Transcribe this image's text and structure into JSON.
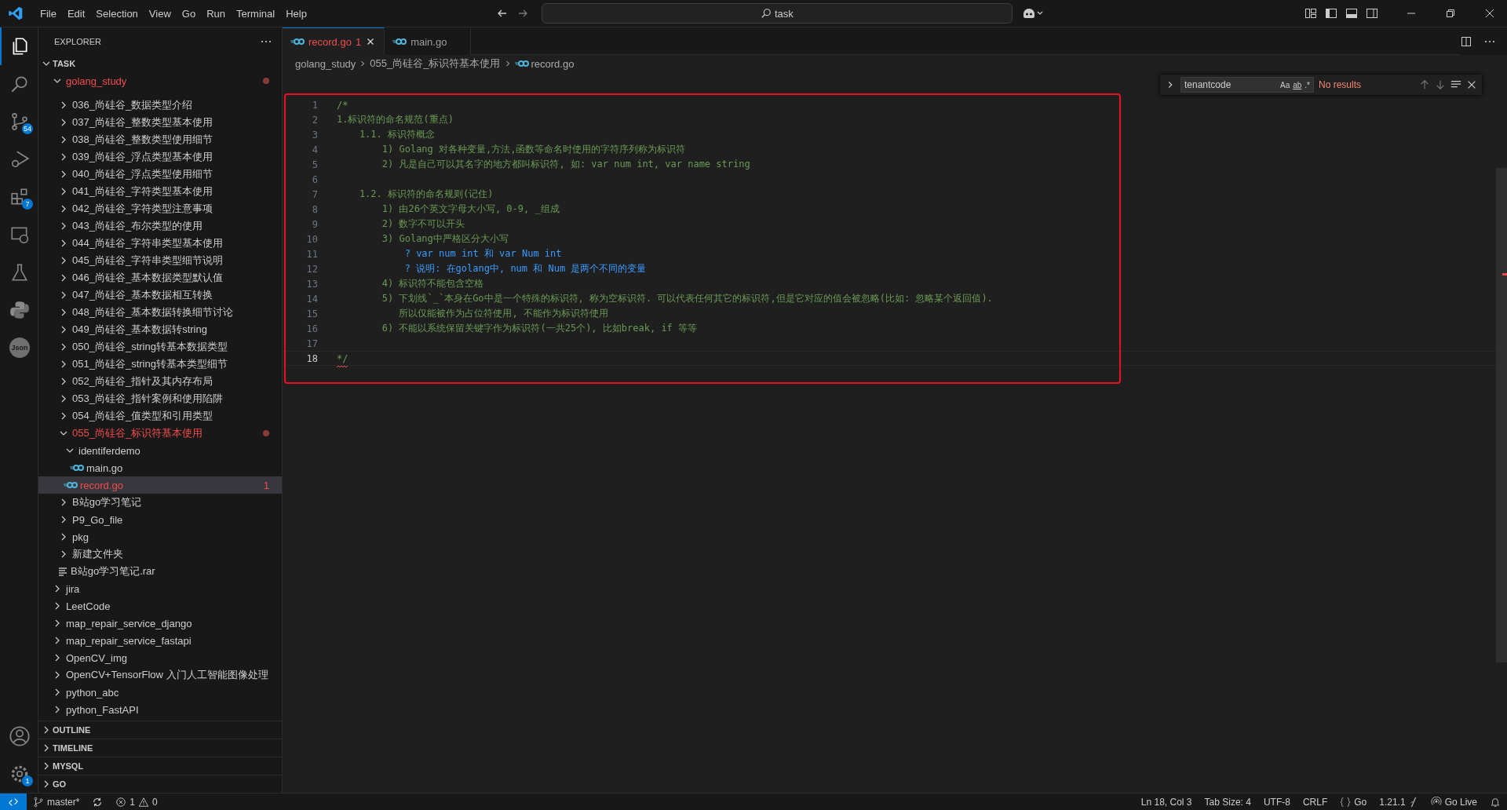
{
  "title_bar": {
    "menu": [
      "File",
      "Edit",
      "Selection",
      "View",
      "Go",
      "Run",
      "Terminal",
      "Help"
    ],
    "search": "task"
  },
  "activity_bar": {
    "items": [
      {
        "kind": "explorer",
        "selected": true
      },
      {
        "kind": "search",
        "selected": false
      },
      {
        "kind": "source-control",
        "selected": false,
        "badge": "54"
      },
      {
        "kind": "run",
        "selected": false
      },
      {
        "kind": "extensions",
        "selected": false,
        "badge": "7"
      },
      {
        "kind": "remote",
        "selected": false
      },
      {
        "kind": "testing",
        "selected": false
      },
      {
        "kind": "python",
        "selected": false
      },
      {
        "kind": "json",
        "selected": false,
        "label": "Json"
      }
    ],
    "bottom": [
      {
        "kind": "accounts"
      },
      {
        "kind": "settings",
        "badge": "1"
      }
    ]
  },
  "sidebar": {
    "title": "EXPLORER",
    "section": "TASK",
    "section_expanded": true,
    "tree": [
      {
        "name": "golang_study",
        "kind": "folder",
        "expanded": true,
        "selected": false,
        "error": true,
        "children": [
          {
            "name": "036_尚硅谷_数据类型介绍",
            "kind": "folder",
            "expanded": false,
            "selected": false,
            "error": false
          },
          {
            "name": "037_尚硅谷_整数类型基本使用",
            "kind": "folder",
            "expanded": false,
            "selected": false,
            "error": false
          },
          {
            "name": "038_尚硅谷_整数类型使用细节",
            "kind": "folder",
            "expanded": false,
            "selected": false,
            "error": false
          },
          {
            "name": "039_尚硅谷_浮点类型基本使用",
            "kind": "folder",
            "expanded": false,
            "selected": false,
            "error": false
          },
          {
            "name": "040_尚硅谷_浮点类型使用细节",
            "kind": "folder",
            "expanded": false,
            "selected": false,
            "error": false
          },
          {
            "name": "041_尚硅谷_字符类型基本使用",
            "kind": "folder",
            "expanded": false,
            "selected": false,
            "error": false
          },
          {
            "name": "042_尚硅谷_字符类型注意事项",
            "kind": "folder",
            "expanded": false,
            "selected": false,
            "error": false
          },
          {
            "name": "043_尚硅谷_布尔类型的使用",
            "kind": "folder",
            "expanded": false,
            "selected": false,
            "error": false
          },
          {
            "name": "044_尚硅谷_字符串类型基本使用",
            "kind": "folder",
            "expanded": false,
            "selected": false,
            "error": false
          },
          {
            "name": "045_尚硅谷_字符串类型细节说明",
            "kind": "folder",
            "expanded": false,
            "selected": false,
            "error": false
          },
          {
            "name": "046_尚硅谷_基本数据类型默认值",
            "kind": "folder",
            "expanded": false,
            "selected": false,
            "error": false
          },
          {
            "name": "047_尚硅谷_基本数据相互转换",
            "kind": "folder",
            "expanded": false,
            "selected": false,
            "error": false
          },
          {
            "name": "048_尚硅谷_基本数据转换细节讨论",
            "kind": "folder",
            "expanded": false,
            "selected": false,
            "error": false
          },
          {
            "name": "049_尚硅谷_基本数据转string",
            "kind": "folder",
            "expanded": false,
            "selected": false,
            "error": false
          },
          {
            "name": "050_尚硅谷_string转基本数据类型",
            "kind": "folder",
            "expanded": false,
            "selected": false,
            "error": false
          },
          {
            "name": "051_尚硅谷_string转基本类型细节",
            "kind": "folder",
            "expanded": false,
            "selected": false,
            "error": false
          },
          {
            "name": "052_尚硅谷_指针及其内存布局",
            "kind": "folder",
            "expanded": false,
            "selected": false,
            "error": false
          },
          {
            "name": "053_尚硅谷_指针案例和使用陷阱",
            "kind": "folder",
            "expanded": false,
            "selected": false,
            "error": false
          },
          {
            "name": "054_尚硅谷_值类型和引用类型",
            "kind": "folder",
            "expanded": false,
            "selected": false,
            "error": false
          },
          {
            "name": "055_尚硅谷_标识符基本使用",
            "kind": "folder",
            "expanded": true,
            "selected": false,
            "error": true,
            "children": [
              {
                "name": "identiferdemo",
                "kind": "folder",
                "expanded": true,
                "selected": false,
                "error": false,
                "children": [
                  {
                    "name": "main.go",
                    "kind": "go",
                    "selected": false,
                    "error": false
                  }
                ]
              },
              {
                "name": "record.go",
                "kind": "go",
                "selected": true,
                "error": true,
                "problems": "1"
              }
            ]
          },
          {
            "name": "B站go学习笔记",
            "kind": "folder",
            "expanded": false,
            "selected": false,
            "error": false
          },
          {
            "name": "P9_Go_file",
            "kind": "folder",
            "expanded": false,
            "selected": false,
            "error": false
          },
          {
            "name": "pkg",
            "kind": "folder",
            "expanded": false,
            "selected": false,
            "error": false
          },
          {
            "name": "新建文件夹",
            "kind": "folder",
            "expanded": false,
            "selected": false,
            "error": false
          },
          {
            "name": "B站go学习笔记.rar",
            "kind": "archive",
            "selected": false,
            "error": false
          }
        ]
      },
      {
        "name": "jira",
        "kind": "folder",
        "expanded": false,
        "selected": false,
        "error": false
      },
      {
        "name": "LeetCode",
        "kind": "folder",
        "expanded": false,
        "selected": false,
        "error": false
      },
      {
        "name": "map_repair_service_django",
        "kind": "folder",
        "expanded": false,
        "selected": false,
        "error": false
      },
      {
        "name": "map_repair_service_fastapi",
        "kind": "folder",
        "expanded": false,
        "selected": false,
        "error": false
      },
      {
        "name": "OpenCV_img",
        "kind": "folder",
        "expanded": false,
        "selected": false,
        "error": false
      },
      {
        "name": "OpenCV+TensorFlow 入门人工智能图像处理",
        "kind": "folder",
        "expanded": false,
        "selected": false,
        "error": false
      },
      {
        "name": "python_abc",
        "kind": "folder",
        "expanded": false,
        "selected": false,
        "error": false
      },
      {
        "name": "python_FastAPI",
        "kind": "folder",
        "expanded": false,
        "selected": false,
        "error": false
      }
    ],
    "panels": [
      "OUTLINE",
      "TIMELINE",
      "MYSQL",
      "GO"
    ]
  },
  "editor": {
    "tabs": [
      {
        "name": "record.go",
        "problems": "1",
        "selected": true,
        "error": true
      },
      {
        "name": "main.go",
        "selected": false,
        "error": false
      }
    ],
    "breadcrumbs": [
      "golang_study",
      "055_尚硅谷_标识符基本使用",
      "record.go"
    ],
    "find": {
      "value": "tenantcode",
      "toggles": [
        "Aa",
        "ab",
        ".*"
      ],
      "result": "No results"
    },
    "lines": [
      {
        "no": "1",
        "text": "/*",
        "kind": "comment",
        "current": false
      },
      {
        "no": "2",
        "text": "1.标识符的命名规范(重点)",
        "kind": "comment",
        "current": false,
        "error": false
      },
      {
        "no": "3",
        "text": "    1.1. 标识符概念",
        "kind": "comment",
        "current": false,
        "error": false
      },
      {
        "no": "4",
        "text": "        1) Golang 对各种变量,方法,函数等命名时使用的字符序列称为标识符",
        "kind": "comment",
        "current": false,
        "error": false
      },
      {
        "no": "5",
        "text": "        2) 凡是自己可以其名字的地方都叫标识符, 如: var num int, var name string",
        "kind": "comment",
        "current": false,
        "error": false
      },
      {
        "no": "6",
        "current": false
      },
      {
        "no": "7",
        "text": "    1.2. 标识符的命名规则(记住)",
        "kind": "comment",
        "current": false,
        "error": false
      },
      {
        "no": "8",
        "text": "        1) 由26个英文字母大小写, 0-9, _组成",
        "kind": "comment",
        "current": false,
        "error": false
      },
      {
        "no": "9",
        "text": "        2) 数字不可以开头",
        "kind": "comment",
        "current": false,
        "error": false
      },
      {
        "no": "10",
        "text": "        3) Golang中严格区分大小写",
        "kind": "comment",
        "current": false,
        "error": false
      },
      {
        "no": "11",
        "text": "            ? var num int 和 var Num int",
        "kind": "question",
        "current": false,
        "error": false
      },
      {
        "no": "12",
        "text": "            ? 说明: 在golang中, num 和 Num 是两个不同的变量",
        "kind": "question",
        "current": false,
        "error": false
      },
      {
        "no": "13",
        "text": "        4) 标识符不能包含空格",
        "kind": "comment",
        "current": false,
        "error": false
      },
      {
        "no": "14",
        "text": "        5) 下划线`_`本身在Go中是一个特殊的标识符, 称为空标识符. 可以代表任何其它的标识符,但是它对应的值会被忽略(比如: 忽略某个返回值).",
        "kind": "comment",
        "current": false,
        "error": false
      },
      {
        "no": "15",
        "text": "           所以仅能被作为占位符使用, 不能作为标识符使用",
        "kind": "comment",
        "current": false,
        "error": false
      },
      {
        "no": "16",
        "text": "        6) 不能以系统保留关键字作为标识符(一共25个), 比如break, if 等等",
        "kind": "comment",
        "current": false,
        "error": false
      },
      {
        "no": "17",
        "current": false
      },
      {
        "no": "18",
        "text": "*/",
        "kind": "comment",
        "current": true,
        "error": true
      }
    ]
  },
  "status_bar": {
    "branch": "master*",
    "errors": "1",
    "warnings": "0",
    "right": [
      {
        "kind": "text",
        "label": "Ln 18, Col 3"
      },
      {
        "kind": "text",
        "label": "Tab Size: 4"
      },
      {
        "kind": "text",
        "label": "UTF-8"
      },
      {
        "kind": "text",
        "label": "CRLF"
      },
      {
        "kind": "language",
        "label": "Go"
      },
      {
        "kind": "version",
        "label": "1.21.1"
      },
      {
        "kind": "live",
        "label": "Go Live"
      },
      {
        "kind": "bell"
      }
    ]
  }
}
